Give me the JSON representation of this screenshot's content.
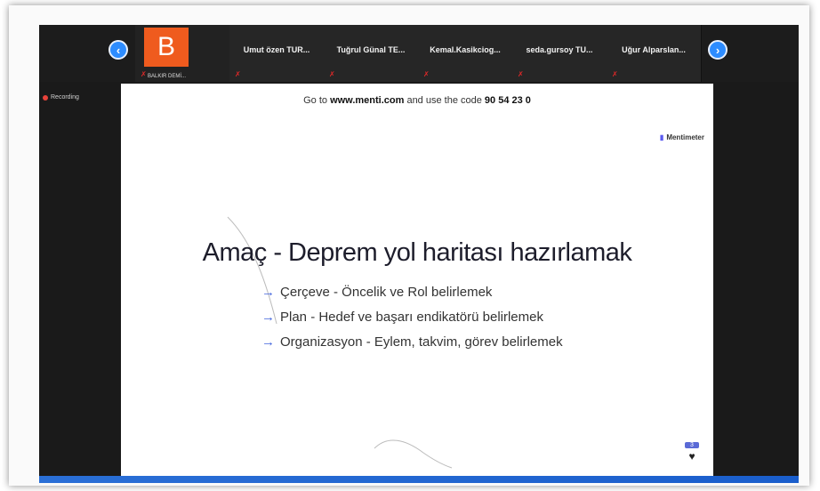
{
  "strip": {
    "prev_icon": "chevron-left-icon",
    "next_icon": "chevron-right-icon",
    "active_tile": {
      "initial": "B",
      "name": "BALKIR DEMİ..."
    },
    "tiles": [
      {
        "name": "Umut özen TUR..."
      },
      {
        "name": "Tuğrul Günal TE..."
      },
      {
        "name": "Kemal.Kasikciog..."
      },
      {
        "name": "seda.gursoy TU..."
      },
      {
        "name": "Uğur Alparslan..."
      }
    ]
  },
  "recording": {
    "label": "Recording"
  },
  "slide": {
    "code_prefix": "Go to ",
    "code_site": "www.menti.com",
    "code_middle": " and use the code ",
    "code_value": "90 54 23 0",
    "brand": "Mentimeter",
    "title": "Amaç - Deprem yol haritası hazırlamak",
    "bullets": [
      "Çerçeve - Öncelik ve Rol belirlemek",
      "Plan - Hedef ve başarı endikatörü belirlemek",
      "Organizasyon - Eylem, takvim, görev belirlemek"
    ],
    "reaction_count": "3"
  },
  "colors": {
    "accent": "#2d8cff",
    "avatar": "#ef5b1e",
    "recording": "#e8423a"
  }
}
